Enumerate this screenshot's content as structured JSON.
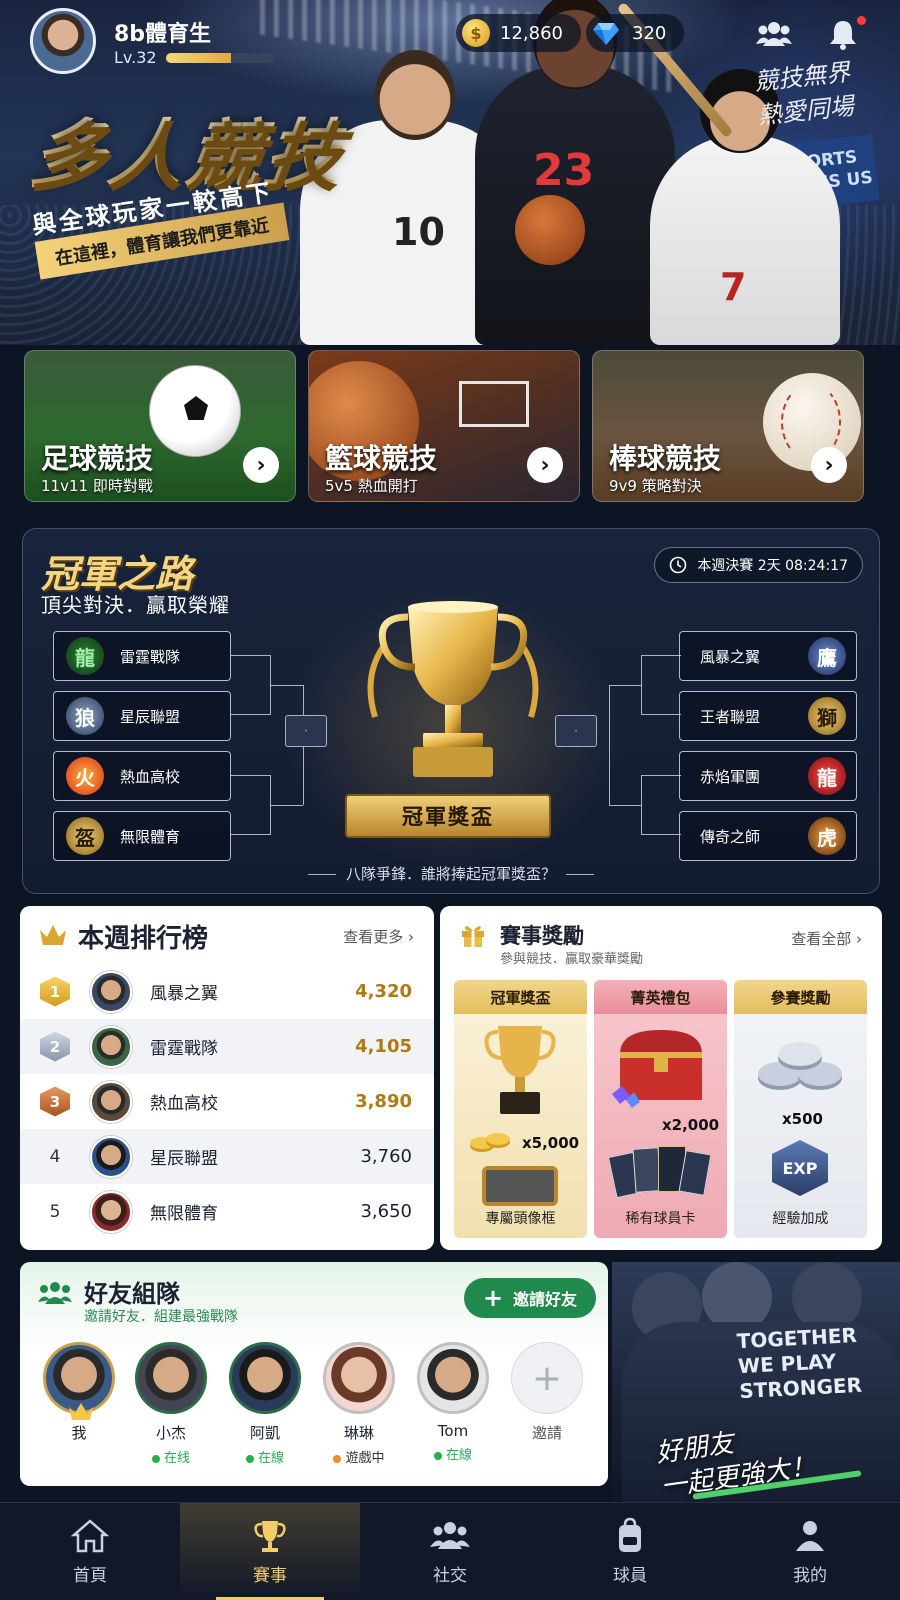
{
  "user": {
    "name": "8b體育生",
    "level": "Lv.32",
    "xp_progress": 0.6
  },
  "currency": {
    "coins": "12,860",
    "gems": "320"
  },
  "icons": {
    "coin": "coin-icon",
    "gem": "diamond-icon",
    "friends": "friends-icon",
    "notification": "bell-icon"
  },
  "hero": {
    "title": "多人競技",
    "subtitle": "與全球玩家一較高下",
    "tagline": "在這裡，體育讓我們更靠近",
    "slogan_line1": "競技無界",
    "slogan_line2": "熱愛同場",
    "sign_line1": "SPORTS",
    "sign_line2": "UNITES US",
    "jersey_soccer": "10",
    "jersey_basketball": "23",
    "jersey_baseball": "7"
  },
  "sports": [
    {
      "title": "足球競技",
      "subtitle": "11v11 即時對戰"
    },
    {
      "title": "籃球競技",
      "subtitle": "5v5 熱血開打"
    },
    {
      "title": "棒球競技",
      "subtitle": "9v9 策略對決"
    }
  ],
  "bracket": {
    "title": "冠軍之路",
    "subtitle": "頂尖對決．贏取榮耀",
    "countdown": "本週決賽 2天 08:24:17",
    "left_teams": [
      "雷霆戰隊",
      "星辰聯盟",
      "熱血高校",
      "無限體育"
    ],
    "right_teams": [
      "風暴之翼",
      "王者聯盟",
      "赤焰軍團",
      "傳奇之師"
    ],
    "trophy_label": "冠軍獎盃",
    "footer": "八隊爭鋒．誰將捧起冠軍獎盃？"
  },
  "ranking": {
    "title": "本週排行榜",
    "more": "查看更多",
    "rows": [
      {
        "rank": "1",
        "name": "風暴之翼",
        "score": "4,320"
      },
      {
        "rank": "2",
        "name": "雷霆戰隊",
        "score": "4,105"
      },
      {
        "rank": "3",
        "name": "熱血高校",
        "score": "3,890"
      },
      {
        "rank": "4",
        "name": "星辰聯盟",
        "score": "3,760"
      },
      {
        "rank": "5",
        "name": "無限體育",
        "score": "3,650"
      }
    ]
  },
  "rewards": {
    "title": "賽事獎勵",
    "subtitle": "參與競技．贏取豪華獎勵",
    "more": "查看全部",
    "cards": [
      {
        "header": "冠軍獎盃",
        "qty": "x5,000",
        "label": "專屬頭像框"
      },
      {
        "header": "菁英禮包",
        "qty": "x2,000",
        "label": "稀有球員卡"
      },
      {
        "header": "參賽獎勵",
        "qty": "x500",
        "label": "經驗加成",
        "badge": "EXP"
      }
    ]
  },
  "friends": {
    "title": "好友組隊",
    "subtitle": "邀請好友．組建最強戰隊",
    "invite_button": "邀請好友",
    "add_label": "邀請",
    "list": [
      {
        "name": "我",
        "status": ""
      },
      {
        "name": "小杰",
        "status": "在线",
        "status_color": "#22b14c"
      },
      {
        "name": "阿凱",
        "status": "在線",
        "status_color": "#22b14c"
      },
      {
        "name": "琳琳",
        "status": "遊戲中",
        "status_color": "#f08a24"
      },
      {
        "name": "Tom",
        "status": "在線",
        "status_color": "#22b14c"
      }
    ]
  },
  "team_banner": {
    "shirt_line1": "TOGETHER",
    "shirt_line2": "WE PLAY",
    "shirt_line3": "STRONGER",
    "slogan_line1": "好朋友",
    "slogan_line2": "一起更強大！"
  },
  "nav": [
    {
      "label": "首頁",
      "icon": "home-icon"
    },
    {
      "label": "賽事",
      "icon": "trophy-icon",
      "active": true
    },
    {
      "label": "社交",
      "icon": "people-icon"
    },
    {
      "label": "球員",
      "icon": "backpack-icon"
    },
    {
      "label": "我的",
      "icon": "profile-icon"
    }
  ],
  "colors": {
    "accent_gold": "#f3cd6a",
    "green": "#1f8a4c",
    "bg": "#0d1424"
  }
}
